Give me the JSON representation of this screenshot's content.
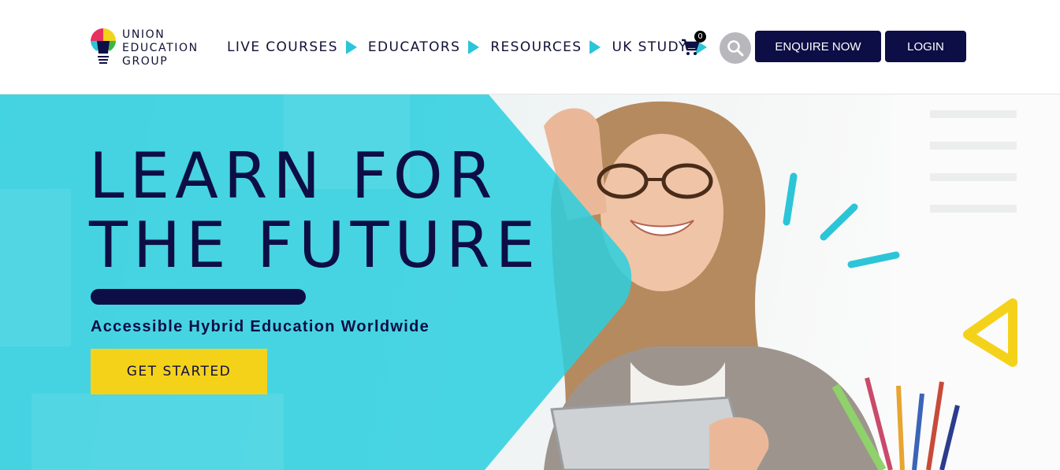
{
  "brand": {
    "logo_lines": [
      "UNION",
      "EDUCATION",
      "GROUP"
    ],
    "logo_icon": "lightbulb-icon"
  },
  "nav": {
    "items": [
      {
        "label": "LIVE COURSES",
        "icon": "play-arrow-icon"
      },
      {
        "label": "EDUCATORS",
        "icon": "play-arrow-icon"
      },
      {
        "label": "RESOURCES",
        "icon": "play-arrow-icon"
      },
      {
        "label": "UK STUDY",
        "icon": "play-arrow-icon"
      }
    ],
    "cart_count": "0",
    "cart_icon": "shopping-cart-icon",
    "search_icon": "search-icon",
    "enquire_label": "ENQUIRE NOW",
    "login_label": "LOGIN"
  },
  "hero": {
    "title_line1": "LEARN FOR",
    "title_line2": "THE FUTURE",
    "subtitle": "Accessible Hybrid Education Worldwide",
    "cta_label": "GET STARTED",
    "image": "student-with-tablet-photo"
  },
  "colors": {
    "navy": "#0d0e45",
    "cyan": "#2cc5d8",
    "yellow": "#f5d21a",
    "search_gray": "#b8b8bc"
  }
}
